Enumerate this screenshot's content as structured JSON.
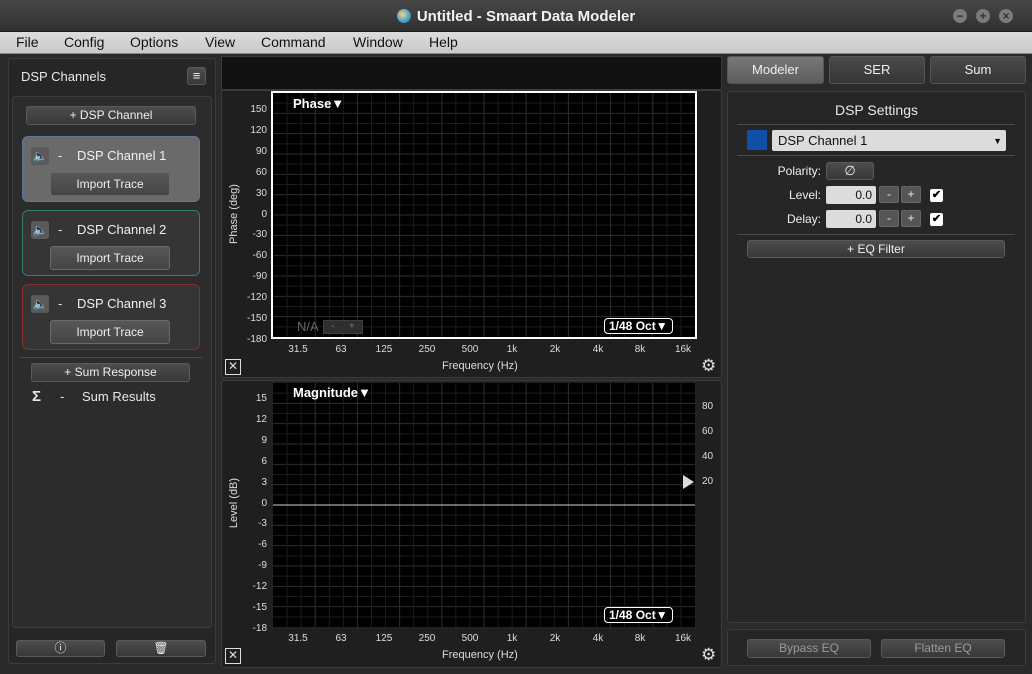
{
  "window": {
    "title": "Untitled - Smaart Data Modeler"
  },
  "menu": [
    "File",
    "Config",
    "Options",
    "View",
    "Command",
    "Window",
    "Help"
  ],
  "left_panel": {
    "title": "DSP Channels",
    "add_channel": "+ DSP Channel",
    "channels": [
      {
        "dash": "-",
        "name": "DSP Channel 1",
        "import": "Import Trace",
        "color": "#5d7a9e"
      },
      {
        "dash": "-",
        "name": "DSP Channel 2",
        "import": "Import Trace",
        "color": "#2f7f6c"
      },
      {
        "dash": "-",
        "name": "DSP Channel 3",
        "import": "Import Trace",
        "color": "#8a2e2e"
      }
    ],
    "sum_response": "+ Sum Response",
    "sum_symbol": "Σ",
    "sum_dash": "-",
    "sum_results": "Sum Results"
  },
  "phase_plot": {
    "name": "Phase▼",
    "ylabel": "Phase (deg)",
    "yticks": [
      "150",
      "120",
      "90",
      "60",
      "30",
      "0",
      "-30",
      "-60",
      "-90",
      "-120",
      "-150",
      "-180"
    ],
    "xticks": [
      "31.5",
      "63",
      "125",
      "250",
      "500",
      "1k",
      "2k",
      "4k",
      "8k",
      "16k"
    ],
    "xlabel": "Frequency (Hz)",
    "na_label": "N/A",
    "minus": "-",
    "plus": "+",
    "smoothing": "1/48 Oct▼"
  },
  "magnitude_plot": {
    "name": "Magnitude▼",
    "ylabel": "Level (dB)",
    "yticks": [
      "15",
      "12",
      "9",
      "6",
      "3",
      "0",
      "-3",
      "-6",
      "-9",
      "-12",
      "-15",
      "-18"
    ],
    "right_ticks": [
      "80",
      "60",
      "40",
      "20"
    ],
    "xticks": [
      "31.5",
      "63",
      "125",
      "250",
      "500",
      "1k",
      "2k",
      "4k",
      "8k",
      "16k"
    ],
    "xlabel": "Frequency (Hz)",
    "smoothing": "1/48 Oct▼"
  },
  "tabs": [
    "Modeler",
    "SER",
    "Sum"
  ],
  "dsp_settings": {
    "title": "DSP Settings",
    "selected_channel": "DSP Channel 1",
    "channel_color": "#0f4fa8",
    "polarity_label": "Polarity:",
    "polarity_symbol": "∅",
    "level_label": "Level:",
    "level_value": "0.0",
    "delay_label": "Delay:",
    "delay_value": "0.0",
    "minus": "-",
    "plus": "+",
    "check": "✔",
    "eq_filter": "+ EQ Filter"
  },
  "bottom_buttons": {
    "bypass_eq": "Bypass EQ",
    "flatten_eq": "Flatten EQ"
  }
}
